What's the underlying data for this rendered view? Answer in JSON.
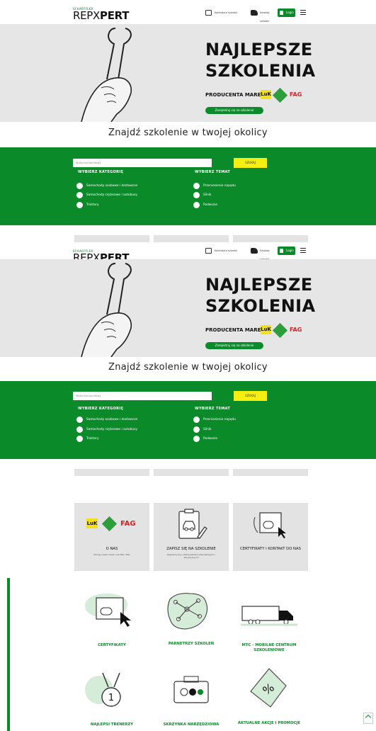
{
  "header": {
    "logo_small": "SCHAEFFLER",
    "logo_repx": "REPX",
    "logo_pert": "PERT",
    "btn_catalog": "Kalendarz szkoleń",
    "btn_cart": "Katalog szkoleń",
    "btn_login": "Login"
  },
  "hero": {
    "line1": "NAJLEPSZE",
    "line2": "SZKOLENIA",
    "producer": "PRODUCENTA MAREK",
    "brand_luk": "LuK",
    "brand_fag": "FAG",
    "cta": "Zarejestruj się na szkolenie"
  },
  "find_title": "Znajdź szkolenie w twojej okolicy",
  "search": {
    "placeholder": "Wpisz kod pocztowy",
    "button": "SZUKAJ"
  },
  "filters": {
    "category_heading": "WYBIERZ KATEGORIĘ",
    "topic_heading": "WYBIERZ TEMAT",
    "categories": [
      "Samochody osobowe i dostawcze",
      "Samochody ciężarowe i autobusy",
      "Traktory"
    ],
    "topics": [
      "Przeniesienie napędu",
      "Silnik",
      "Podwozie"
    ]
  },
  "cards": [
    {
      "title": "O NAS",
      "subtitle": "Poznaj nasze marki: LuK INA i FAG"
    },
    {
      "title": "ZAPISZ SIĘ NA SZKOLENIE",
      "subtitle": "Zapoznaj się z ofertą szkoleń internetowych i stacjonarnych"
    },
    {
      "title": "CERTYFIKATY I KONTAKT DO NAS",
      "subtitle": ""
    }
  ],
  "features": [
    "CERTYFIKATY",
    "PARNETRZY SZKOLEŃ",
    "MTC - MOBILNE CENTRUM SZKOLENIOWE",
    "NAJLEPSI TRENERZY",
    "SKRZYNKA NARZĘDZIOWA",
    "AKTUALNE AKCJE I PROMOCJE"
  ],
  "colors": {
    "green": "#0b8a2a",
    "yellow": "#f5ee12",
    "hero_bg": "#e6e6e6"
  }
}
